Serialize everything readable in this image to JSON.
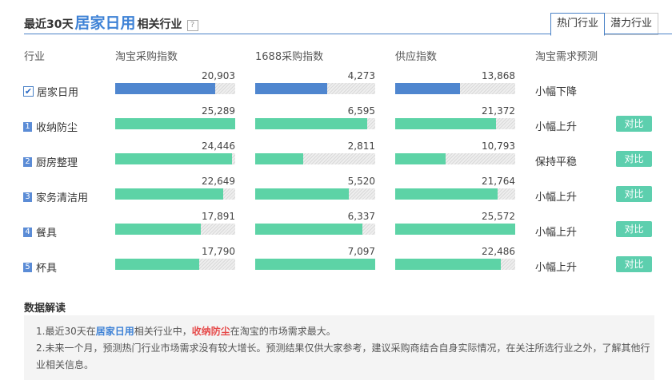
{
  "header": {
    "prefix": "最近30天",
    "category": "居家日用",
    "suffix": "相关行业",
    "help": "?"
  },
  "tabs": [
    {
      "label": "热门行业",
      "active": true
    },
    {
      "label": "潜力行业",
      "active": false
    }
  ],
  "columns": [
    "行业",
    "淘宝采购指数",
    "1688采购指数",
    "供应指数",
    "淘宝需求预测"
  ],
  "rows": [
    {
      "badge": "✔",
      "name": "居家日用",
      "taobao": "20,903",
      "taobao_fill": 0.83,
      "a1688": "4,273",
      "a1688_fill": 0.6,
      "supply": "13,868",
      "supply_fill": 0.54,
      "trend": "小幅下降",
      "compare": ""
    },
    {
      "badge": "1",
      "name": "收纳防尘",
      "taobao": "25,289",
      "taobao_fill": 1.0,
      "a1688": "6,595",
      "a1688_fill": 0.93,
      "supply": "21,372",
      "supply_fill": 0.84,
      "trend": "小幅上升",
      "compare": "对比"
    },
    {
      "badge": "2",
      "name": "厨房整理",
      "taobao": "24,446",
      "taobao_fill": 0.97,
      "a1688": "2,811",
      "a1688_fill": 0.4,
      "supply": "10,793",
      "supply_fill": 0.42,
      "trend": "保持平稳",
      "compare": "对比"
    },
    {
      "badge": "3",
      "name": "家务清洁用",
      "taobao": "22,649",
      "taobao_fill": 0.9,
      "a1688": "5,520",
      "a1688_fill": 0.78,
      "supply": "21,764",
      "supply_fill": 0.85,
      "trend": "小幅上升",
      "compare": "对比"
    },
    {
      "badge": "4",
      "name": "餐具",
      "taobao": "17,891",
      "taobao_fill": 0.71,
      "a1688": "6,337",
      "a1688_fill": 0.89,
      "supply": "25,572",
      "supply_fill": 1.0,
      "trend": "小幅上升",
      "compare": "对比"
    },
    {
      "badge": "5",
      "name": "杯具",
      "taobao": "17,790",
      "taobao_fill": 0.7,
      "a1688": "7,097",
      "a1688_fill": 1.0,
      "supply": "22,486",
      "supply_fill": 0.88,
      "trend": "小幅上升",
      "compare": "对比"
    }
  ],
  "analysis": {
    "title": "数据解读",
    "l1_a": "1.最近30天在",
    "l1_b": "居家日用",
    "l1_c": "相关行业中，",
    "l1_d": "收纳防尘",
    "l1_e": "在淘宝的市场需求最大。",
    "l2": "2.未来一个月，预测热门行业市场需求没有较大增长。预测结果仅供大家参考，建议采购商结合自身实际情况，在关注所选行业之外，了解其他行业相关信息。"
  },
  "colors": {
    "selected_bar": "#4f86cf",
    "bar": "#5dd3a6",
    "accent": "#3e82d6",
    "highlight": "#e64c4c"
  }
}
